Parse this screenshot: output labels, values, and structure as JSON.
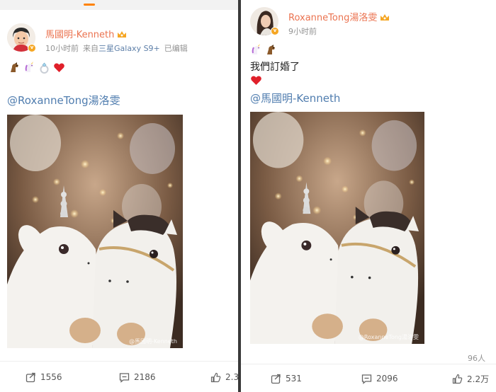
{
  "left_post": {
    "username": "馬國明-Kenneth",
    "time": "10小时前",
    "source_prefix": "来自",
    "device": "三星Galaxy S9+",
    "edited": "已编辑",
    "emojis": [
      "horse",
      "unicorn",
      "ring",
      "heart"
    ],
    "mention": "@RoxanneTong湯洛雯",
    "watermark": "@馬國明-Kenneth",
    "actions": {
      "repost": "1556",
      "comment": "2186",
      "like": "2.3"
    }
  },
  "right_post": {
    "username": "RoxanneTong湯洛雯",
    "time": "9小时前",
    "emojis": [
      "unicorn",
      "horse"
    ],
    "text": "我們訂婚了",
    "heart": "heart",
    "mention": "@馬國明-Kenneth",
    "watermark": "@RoxanneTong湯洛雯",
    "likes_summary": "96人",
    "actions": {
      "repost": "531",
      "comment": "2096",
      "like": "2.2万"
    }
  },
  "colors": {
    "username": "#eb7350",
    "mention": "#507daf",
    "meta": "#939393",
    "tab_indicator": "#ff8200",
    "divider": "#3a3a3a"
  }
}
